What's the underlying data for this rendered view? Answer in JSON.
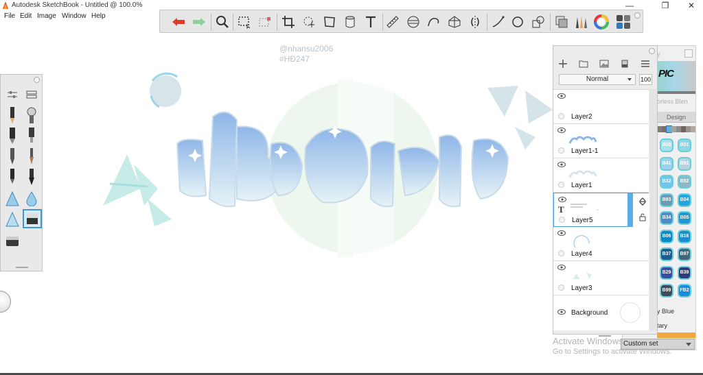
{
  "window": {
    "title": "Autodesk SketchBook - Untitled @ 100.0%",
    "minimize": "—",
    "maximize": "❐",
    "close": "✕"
  },
  "menu": {
    "items": [
      "File",
      "Edit",
      "Image",
      "Window",
      "Help"
    ]
  },
  "toolbar": {
    "icons": [
      "undo-icon",
      "redo-icon",
      "zoom-icon",
      "select-icon",
      "crop-select-icon",
      "crop-icon",
      "transform-icon",
      "distort-icon",
      "fill-icon",
      "text-icon",
      "ruler-icon",
      "ellipse-guide-icon",
      "french-curve-icon",
      "perspective-icon",
      "symmetry-icon",
      "stroke-icon",
      "circle-icon",
      "shapes-icon",
      "copic-library-icon",
      "brush-library-icon",
      "color-wheel-icon",
      "palette-icon"
    ]
  },
  "canvas": {
    "watermark_line1": "@nhansu2006",
    "watermark_line2": "#HĐ247",
    "artwork_text": "BoDJeJe"
  },
  "layers": {
    "blend_mode": "Normal",
    "opacity": "100",
    "items": [
      {
        "name": "Layer2",
        "selected": false,
        "text_layer": false
      },
      {
        "name": "Layer1-1",
        "selected": false,
        "text_layer": false
      },
      {
        "name": "Layer1",
        "selected": false,
        "text_layer": false
      },
      {
        "name": "Layer5",
        "selected": true,
        "text_layer": true
      },
      {
        "name": "Layer4",
        "selected": false,
        "text_layer": false
      },
      {
        "name": "Layer3",
        "selected": false,
        "text_layer": false
      }
    ],
    "background_label": "Background"
  },
  "copic": {
    "logo": "PIC",
    "subtitle": "orless Blen",
    "tab_label": "Design",
    "label_blue": "y Blue",
    "label_tary": "tary",
    "custom_set": "Custom set",
    "chips": [
      [
        "B00",
        "#a6e3ec"
      ],
      [
        "B01",
        "#8fd7e8"
      ],
      [
        "B41",
        "#9ed2ec"
      ],
      [
        "B91",
        "#b8d3de"
      ],
      [
        "B32",
        "#71c4ea"
      ],
      [
        "B52",
        "#8db9c6"
      ],
      [
        "B93",
        "#6b9bb4"
      ],
      [
        "B04",
        "#23a6e0"
      ],
      [
        "B34",
        "#4d8cc9"
      ],
      [
        "B05",
        "#1c98d6"
      ],
      [
        "B06",
        "#0f87c4"
      ],
      [
        "B16",
        "#1b8ccd"
      ],
      [
        "B37",
        "#1e5d8c"
      ],
      [
        "B97",
        "#426678"
      ],
      [
        "B29",
        "#3b4ca6"
      ],
      [
        "B39",
        "#2d3b7d"
      ],
      [
        "B99",
        "#3d4b5c"
      ],
      [
        "FB2",
        "#1a8ce0"
      ]
    ],
    "strip_colors": [
      "#7d7d7d",
      "#7a6e69",
      "#5cb1e0",
      "#a3a3a3",
      "#8d8d8d",
      "#6e6360",
      "#99928e",
      "#b7a99c"
    ]
  },
  "system": {
    "activate_line1": "Activate Windows",
    "activate_line2": "Go to Settings to activate Windows."
  }
}
